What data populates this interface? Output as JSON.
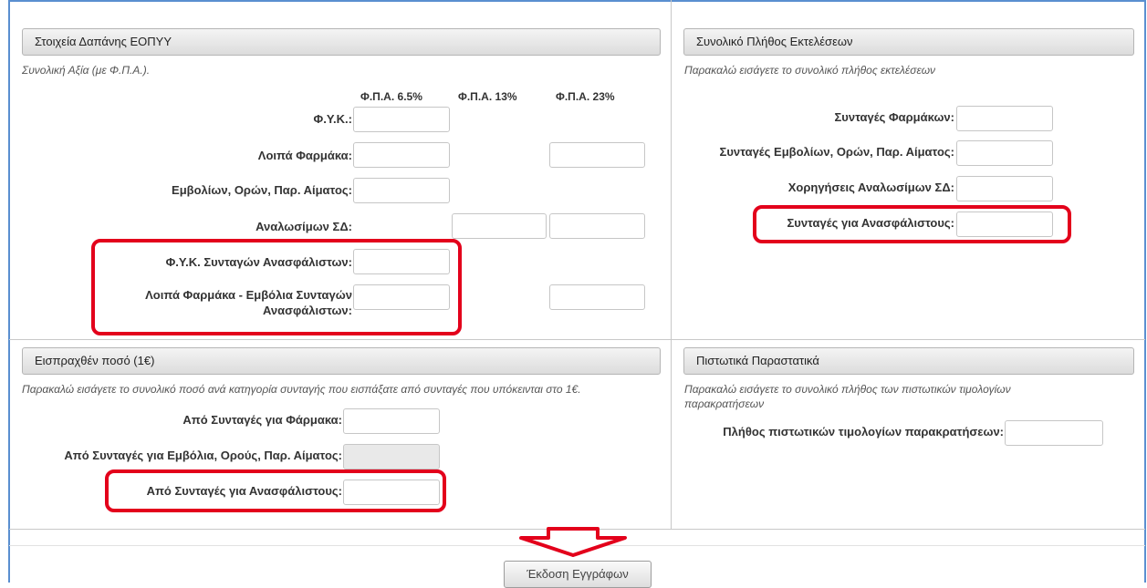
{
  "left_panel": {
    "title": "Στοιχεία Δαπάνης ΕΟΠΥΥ",
    "description": "Συνολική Αξία (με Φ.Π.Α.).",
    "columns": [
      "Φ.Π.Α. 6.5%",
      "Φ.Π.Α. 13%",
      "Φ.Π.Α. 23%"
    ],
    "rows": [
      {
        "label": "Φ.Υ.Κ.:"
      },
      {
        "label": "Λοιπά Φαρμάκα:"
      },
      {
        "label": "Εμβολίων, Ορών, Παρ. Αίματος:"
      },
      {
        "label": "Αναλωσίμων ΣΔ:"
      },
      {
        "label": "Φ.Υ.Κ. Συνταγών Ανασφάλιστων:"
      },
      {
        "label_line1": "Λοιπά Φαρμάκα - Εμβόλια Συνταγών",
        "label_line2": "Ανασφάλιστων:"
      }
    ]
  },
  "right_panel": {
    "title": "Συνολικό Πλήθος Εκτελέσεων",
    "description": "Παρακαλώ εισάγετε το συνολικό πλήθος εκτελέσεων",
    "rows": [
      {
        "label": "Συνταγές Φαρμάκων:"
      },
      {
        "label": "Συνταγές Εμβολίων, Ορών, Παρ. Αίματος:"
      },
      {
        "label": "Χορηγήσεις Αναλωσίμων ΣΔ:"
      },
      {
        "label": "Συνταγές για Ανασφάλιστους:"
      }
    ]
  },
  "collected_panel": {
    "title": "Εισπραχθέν ποσό (1€)",
    "description": "Παρακαλώ εισάγετε το συνολικό ποσό ανά κατηγορία συνταγής που εισπάξατε από συνταγές που υπόκεινται στο 1€.",
    "rows": [
      {
        "label": "Από Συνταγές για Φάρμακα:"
      },
      {
        "label": "Από Συνταγές για Εμβόλια, Ορούς, Παρ. Αίματος:"
      },
      {
        "label": "Από Συνταγές για Ανασφάλιστους:"
      }
    ]
  },
  "credit_panel": {
    "title": "Πιστωτικά Παραστατικά",
    "description_line1": "Παρακαλώ εισάγετε το συνολικό πλήθος των πιστωτικών τιμολογίων",
    "description_line2": "παρακρατήσεων",
    "rows": [
      {
        "label": "Πλήθος πιστωτικών τιμολογίων παρακρατήσεων:"
      }
    ]
  },
  "actions": {
    "issue_button": "Έκδοση Εγγράφων"
  },
  "colors": {
    "highlight": "#e3001b",
    "frame": "#5a8fd0"
  }
}
